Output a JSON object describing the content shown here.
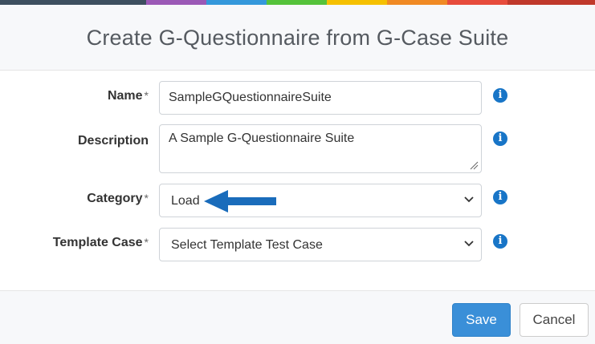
{
  "colors": {
    "header_stripe": [
      "#3d4f5f",
      "#9b59b6",
      "#3498db",
      "#55c23a",
      "#f5c000",
      "#f08a24",
      "#e74c3c",
      "#c0392b"
    ],
    "primary": "#3a8fd8",
    "info": "#1875c7",
    "annotation_arrow": "#1a6cbb"
  },
  "dialog": {
    "title": "Create G-Questionnaire from G-Case Suite"
  },
  "form": {
    "name": {
      "label": "Name",
      "required_mark": "*",
      "value": "SampleGQuestionnaireSuite"
    },
    "description": {
      "label": "Description",
      "value": "A Sample G-Questionnaire Suite"
    },
    "category": {
      "label": "Category",
      "required_mark": "*",
      "value": "Load"
    },
    "template_case": {
      "label": "Template Case",
      "required_mark": "*",
      "value": "Select Template Test Case"
    },
    "info_glyph": "i"
  },
  "footer": {
    "save_label": "Save",
    "cancel_label": "Cancel"
  },
  "annotation": {
    "arrow_target": "category-select"
  }
}
